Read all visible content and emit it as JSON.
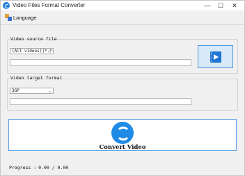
{
  "window": {
    "title": "Video Files Format Converter",
    "controls": {
      "minimize": "—",
      "maximize": "☐",
      "close": "✕"
    }
  },
  "menu": {
    "language_label": "Language"
  },
  "source": {
    "group_label": "Video source file",
    "filter_value": "(All videos)|*.*",
    "path_value": ""
  },
  "target": {
    "group_label": "Video target format",
    "format_value": "3GP",
    "path_value": ""
  },
  "convert": {
    "label": "Convert Video"
  },
  "progress": {
    "label": "Progress :",
    "value": "0.00 / 0.00"
  },
  "colors": {
    "accent": "#1f8be6",
    "play_button_bg": "#d8e9f9"
  },
  "icons": {
    "app": "converter-app-icon",
    "language": "language-icon",
    "open_source": "video-file-icon",
    "convert": "convert-refresh-icon"
  }
}
